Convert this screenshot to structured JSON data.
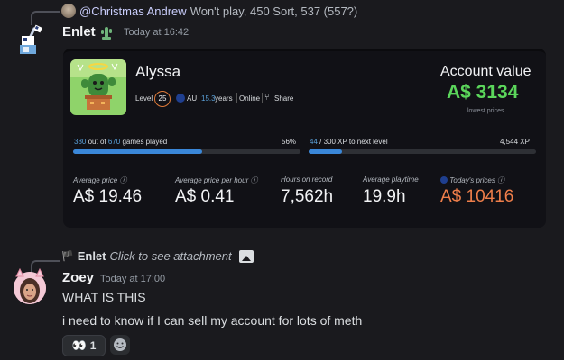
{
  "reply1": {
    "mention": "@Christmas Andrew",
    "text": "Won't play, 450 Sort, 537 (557?)"
  },
  "bot_message": {
    "author": "Enlet",
    "timestamp": "Today at 16:42",
    "card": {
      "username": "Alyssa",
      "level_label": "Level",
      "level": "25",
      "region": "AU",
      "years": "15.3",
      "years_suffix": "years",
      "status": "Online",
      "share_label": "Share",
      "account_value_label": "Account value",
      "account_value": "A$ 3134",
      "account_value_sub": "lowest prices",
      "games": {
        "played": "380",
        "out_of_label": "out of",
        "total": "670",
        "suffix": "games played",
        "percent_label": "56%",
        "fraction": 0.567
      },
      "xp": {
        "current": "44",
        "text": "/ 300 XP to next level",
        "total": "4,544 XP",
        "fraction": 0.147
      },
      "stats": [
        {
          "label": "Average price ⓘ",
          "value": "A$ 19.46"
        },
        {
          "label": "Average price per hour ⓘ",
          "value": "A$ 0.41"
        },
        {
          "label": "Hours on record",
          "value": "7,562h"
        },
        {
          "label": "Average playtime",
          "value": "19.9h"
        },
        {
          "label": "Today's prices ⓘ",
          "value": "A$ 10416"
        }
      ],
      "accent_green": "#5bd65b",
      "accent_orange": "#ee7e4a",
      "accent_blue": "#3a87d8"
    }
  },
  "reply2": {
    "author": "Enlet",
    "text": "Click to see attachment"
  },
  "user_message": {
    "author": "Zoey",
    "timestamp": "Today at 17:00",
    "lines": [
      "WHAT IS THIS",
      "i need to know if I can sell my account for lots of meth"
    ],
    "reaction": {
      "emoji": "👀",
      "count": "1"
    }
  }
}
